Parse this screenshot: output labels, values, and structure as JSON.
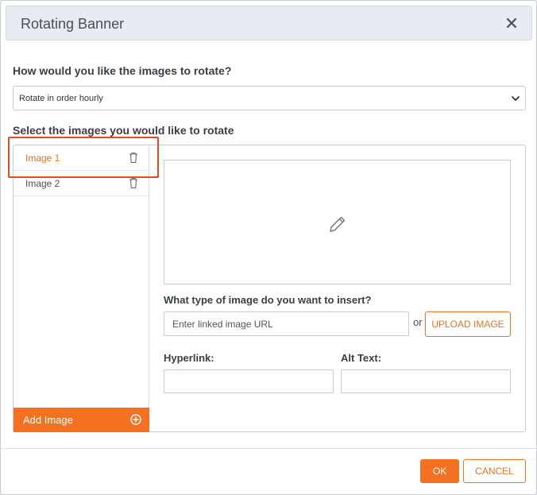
{
  "dialog": {
    "title": "Rotating Banner",
    "close_icon": "close-icon"
  },
  "rotation": {
    "question": "How would you like the images to rotate?",
    "selected": "Rotate in order hourly"
  },
  "images": {
    "question": "Select the images you would like to rotate",
    "items": [
      {
        "label": "Image 1",
        "active": true,
        "icon": "trash-icon"
      },
      {
        "label": "Image 2",
        "active": false,
        "icon": "trash-icon"
      }
    ],
    "add_label": "Add Image",
    "add_icon": "plus-circle-icon"
  },
  "editor": {
    "preview_icon": "pencil-icon",
    "type_question": "What type of image do you want to insert?",
    "url_placeholder": "Enter linked image URL",
    "or_text": "or",
    "upload_label": "UPLOAD IMAGE",
    "hyperlink_label": "Hyperlink:",
    "hyperlink_value": "",
    "alt_text_label": "Alt Text:",
    "alt_text_value": ""
  },
  "footer": {
    "ok_label": "OK",
    "cancel_label": "CANCEL"
  },
  "colors": {
    "accent": "#f37121",
    "highlight": "#e04e1a"
  }
}
